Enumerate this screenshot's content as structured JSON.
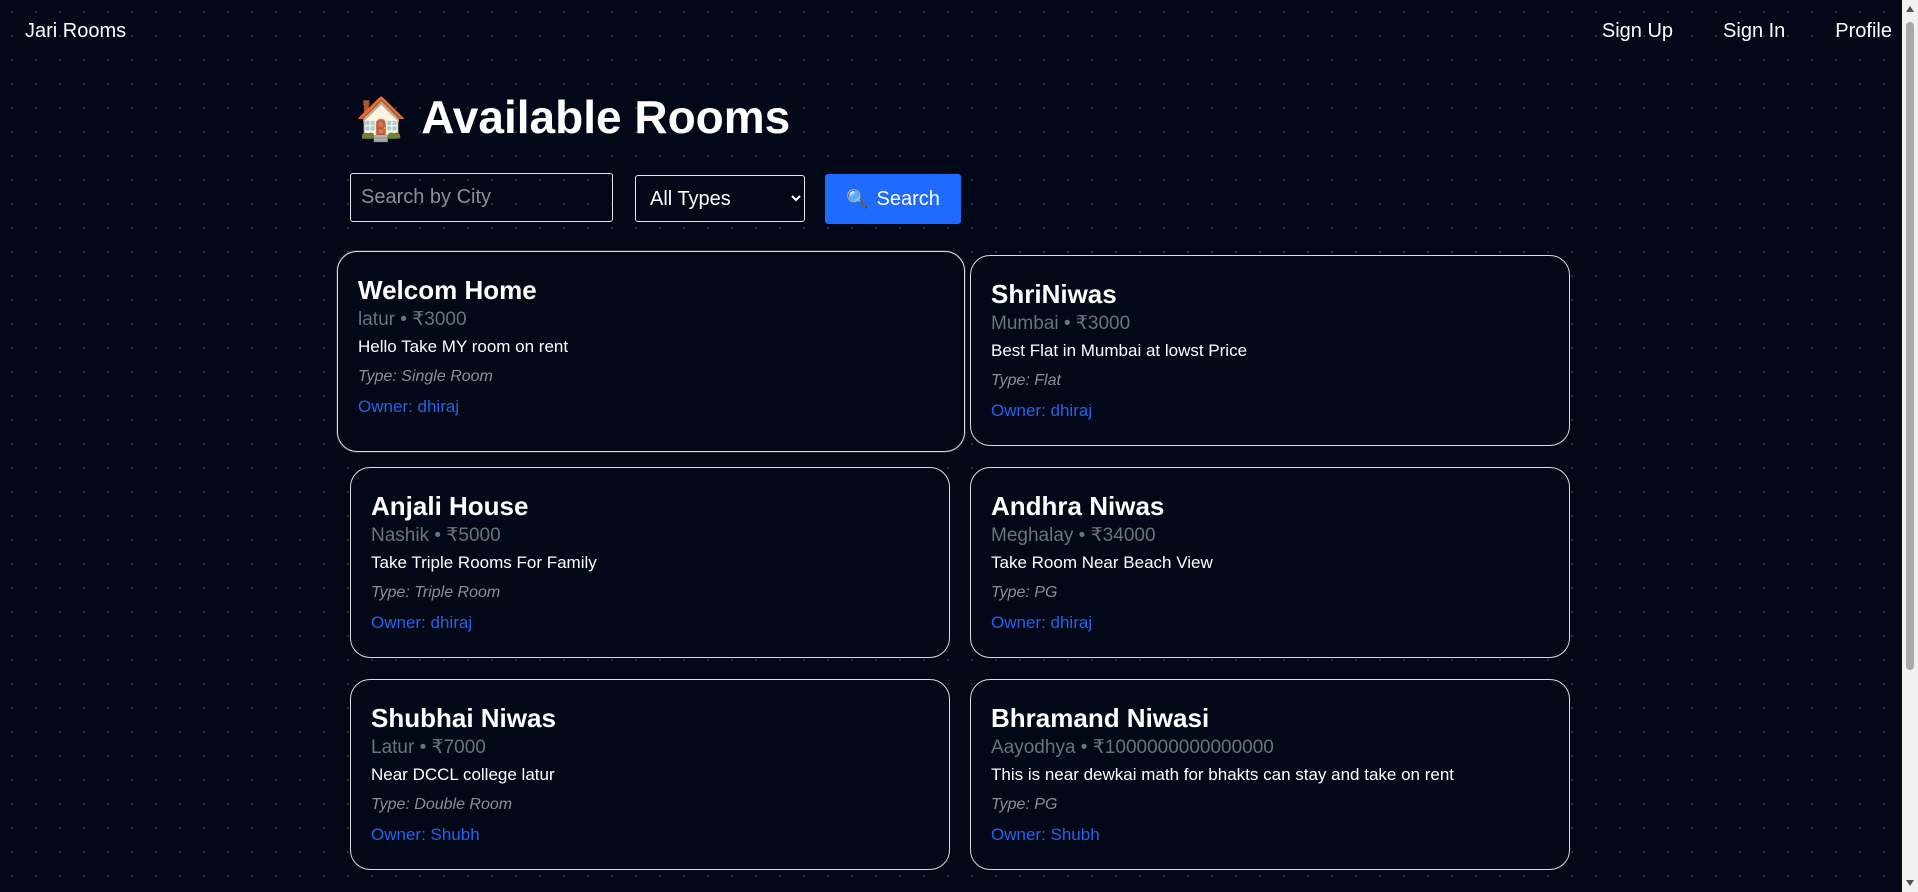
{
  "nav": {
    "brand": "Jari Rooms",
    "links": [
      "Sign Up",
      "Sign In",
      "Profile"
    ]
  },
  "page": {
    "title_emoji": "🏠",
    "title": "Available Rooms"
  },
  "search": {
    "placeholder": "Search by City",
    "value": "",
    "type_selected": "All Types",
    "button_icon": "🔍",
    "button_label": "Search"
  },
  "rooms": [
    {
      "name": "Welcom Home",
      "meta": "latur • ₹3000",
      "desc": "Hello Take MY room on rent",
      "type": "Type: Single Room",
      "owner": "Owner: dhiraj"
    },
    {
      "name": "ShriNiwas",
      "meta": "Mumbai • ₹3000",
      "desc": "Best Flat in Mumbai at lowst Price",
      "type": "Type: Flat",
      "owner": "Owner: dhiraj"
    },
    {
      "name": "Anjali House",
      "meta": "Nashik • ₹5000",
      "desc": "Take Triple Rooms For Family",
      "type": "Type: Triple Room",
      "owner": "Owner: dhiraj"
    },
    {
      "name": "Andhra Niwas",
      "meta": "Meghalay • ₹34000",
      "desc": "Take Room Near Beach View",
      "type": "Type: PG",
      "owner": "Owner: dhiraj"
    },
    {
      "name": "Shubhai Niwas",
      "meta": "Latur • ₹7000",
      "desc": "Near DCCL college latur",
      "type": "Type: Double Room",
      "owner": "Owner: Shubh"
    },
    {
      "name": "Bhramand Niwasi",
      "meta": "Aayodhya • ₹1000000000000000",
      "desc": "This is near dewkai math for bhakts can stay and take on rent",
      "type": "Type: PG",
      "owner": "Owner: Shubh"
    }
  ],
  "colors": {
    "background": "#020817",
    "accent": "#1f6bff",
    "owner_link": "#2563eb"
  }
}
